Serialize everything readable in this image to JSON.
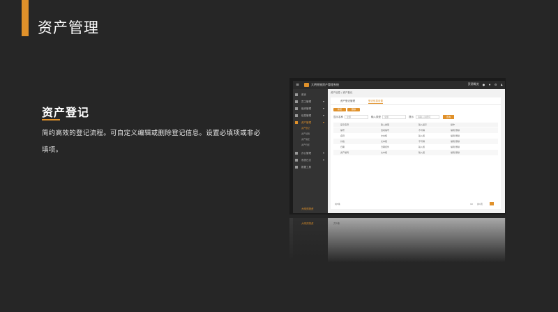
{
  "slide": {
    "title": "资产管理",
    "section_title": "资产登记",
    "description": "简约高效的登记流程。可自定义编辑或删除登记信息。设置必填项或非必填项。"
  },
  "app": {
    "name": "大明亮物资产管理系统",
    "topbar_right": [
      "资源概览",
      "●",
      "♦",
      "⚙",
      "♟"
    ],
    "sidebar": [
      {
        "label": "首页",
        "arrow": ""
      },
      {
        "label": "员工管理",
        "arrow": "▾"
      },
      {
        "label": "组织管理",
        "arrow": "▾"
      },
      {
        "label": "信息管理",
        "arrow": "▾"
      },
      {
        "label": "资产管理",
        "arrow": "▾"
      },
      {
        "label": "办公管理",
        "arrow": "▾"
      },
      {
        "label": "系统日志",
        "arrow": "▾"
      },
      {
        "label": "数据工具",
        "arrow": ""
      }
    ],
    "sidebar_sub": [
      "资产登记",
      "资产领用",
      "资产借还",
      "资产归还"
    ],
    "sidebar_footer": "大明亮物资",
    "breadcrumb": "资产信息 / 资产登记",
    "tabs": [
      "资产登记管理",
      "登记信息设置"
    ],
    "buttons": [
      "新增",
      "删除"
    ],
    "filters": [
      {
        "label": "显示名称",
        "placeholder": "全部"
      },
      {
        "label": "输入类型",
        "placeholder": "全部"
      },
      {
        "label": "提示",
        "placeholder": "请输入关键词"
      }
    ],
    "query_button": "查询",
    "table": {
      "headers": [
        "显示名称",
        "输入类型",
        "输入提示",
        "操作"
      ],
      "rows": [
        [
          "编号",
          "自动编号",
          "不可填",
          "编辑  删除"
        ],
        [
          "名称",
          "文本框",
          "输入框",
          "编辑  删除"
        ],
        [
          "价格",
          "文本框",
          "不可填",
          "编辑  删除"
        ],
        [
          "日期",
          "日期控件",
          "输入框",
          "编辑  删除"
        ],
        [
          "资产编码",
          "文本框",
          "输入框",
          "编辑  删除"
        ]
      ]
    },
    "pagination": {
      "total": "共5条",
      "per_page": "10",
      "pages": "共1页"
    }
  }
}
